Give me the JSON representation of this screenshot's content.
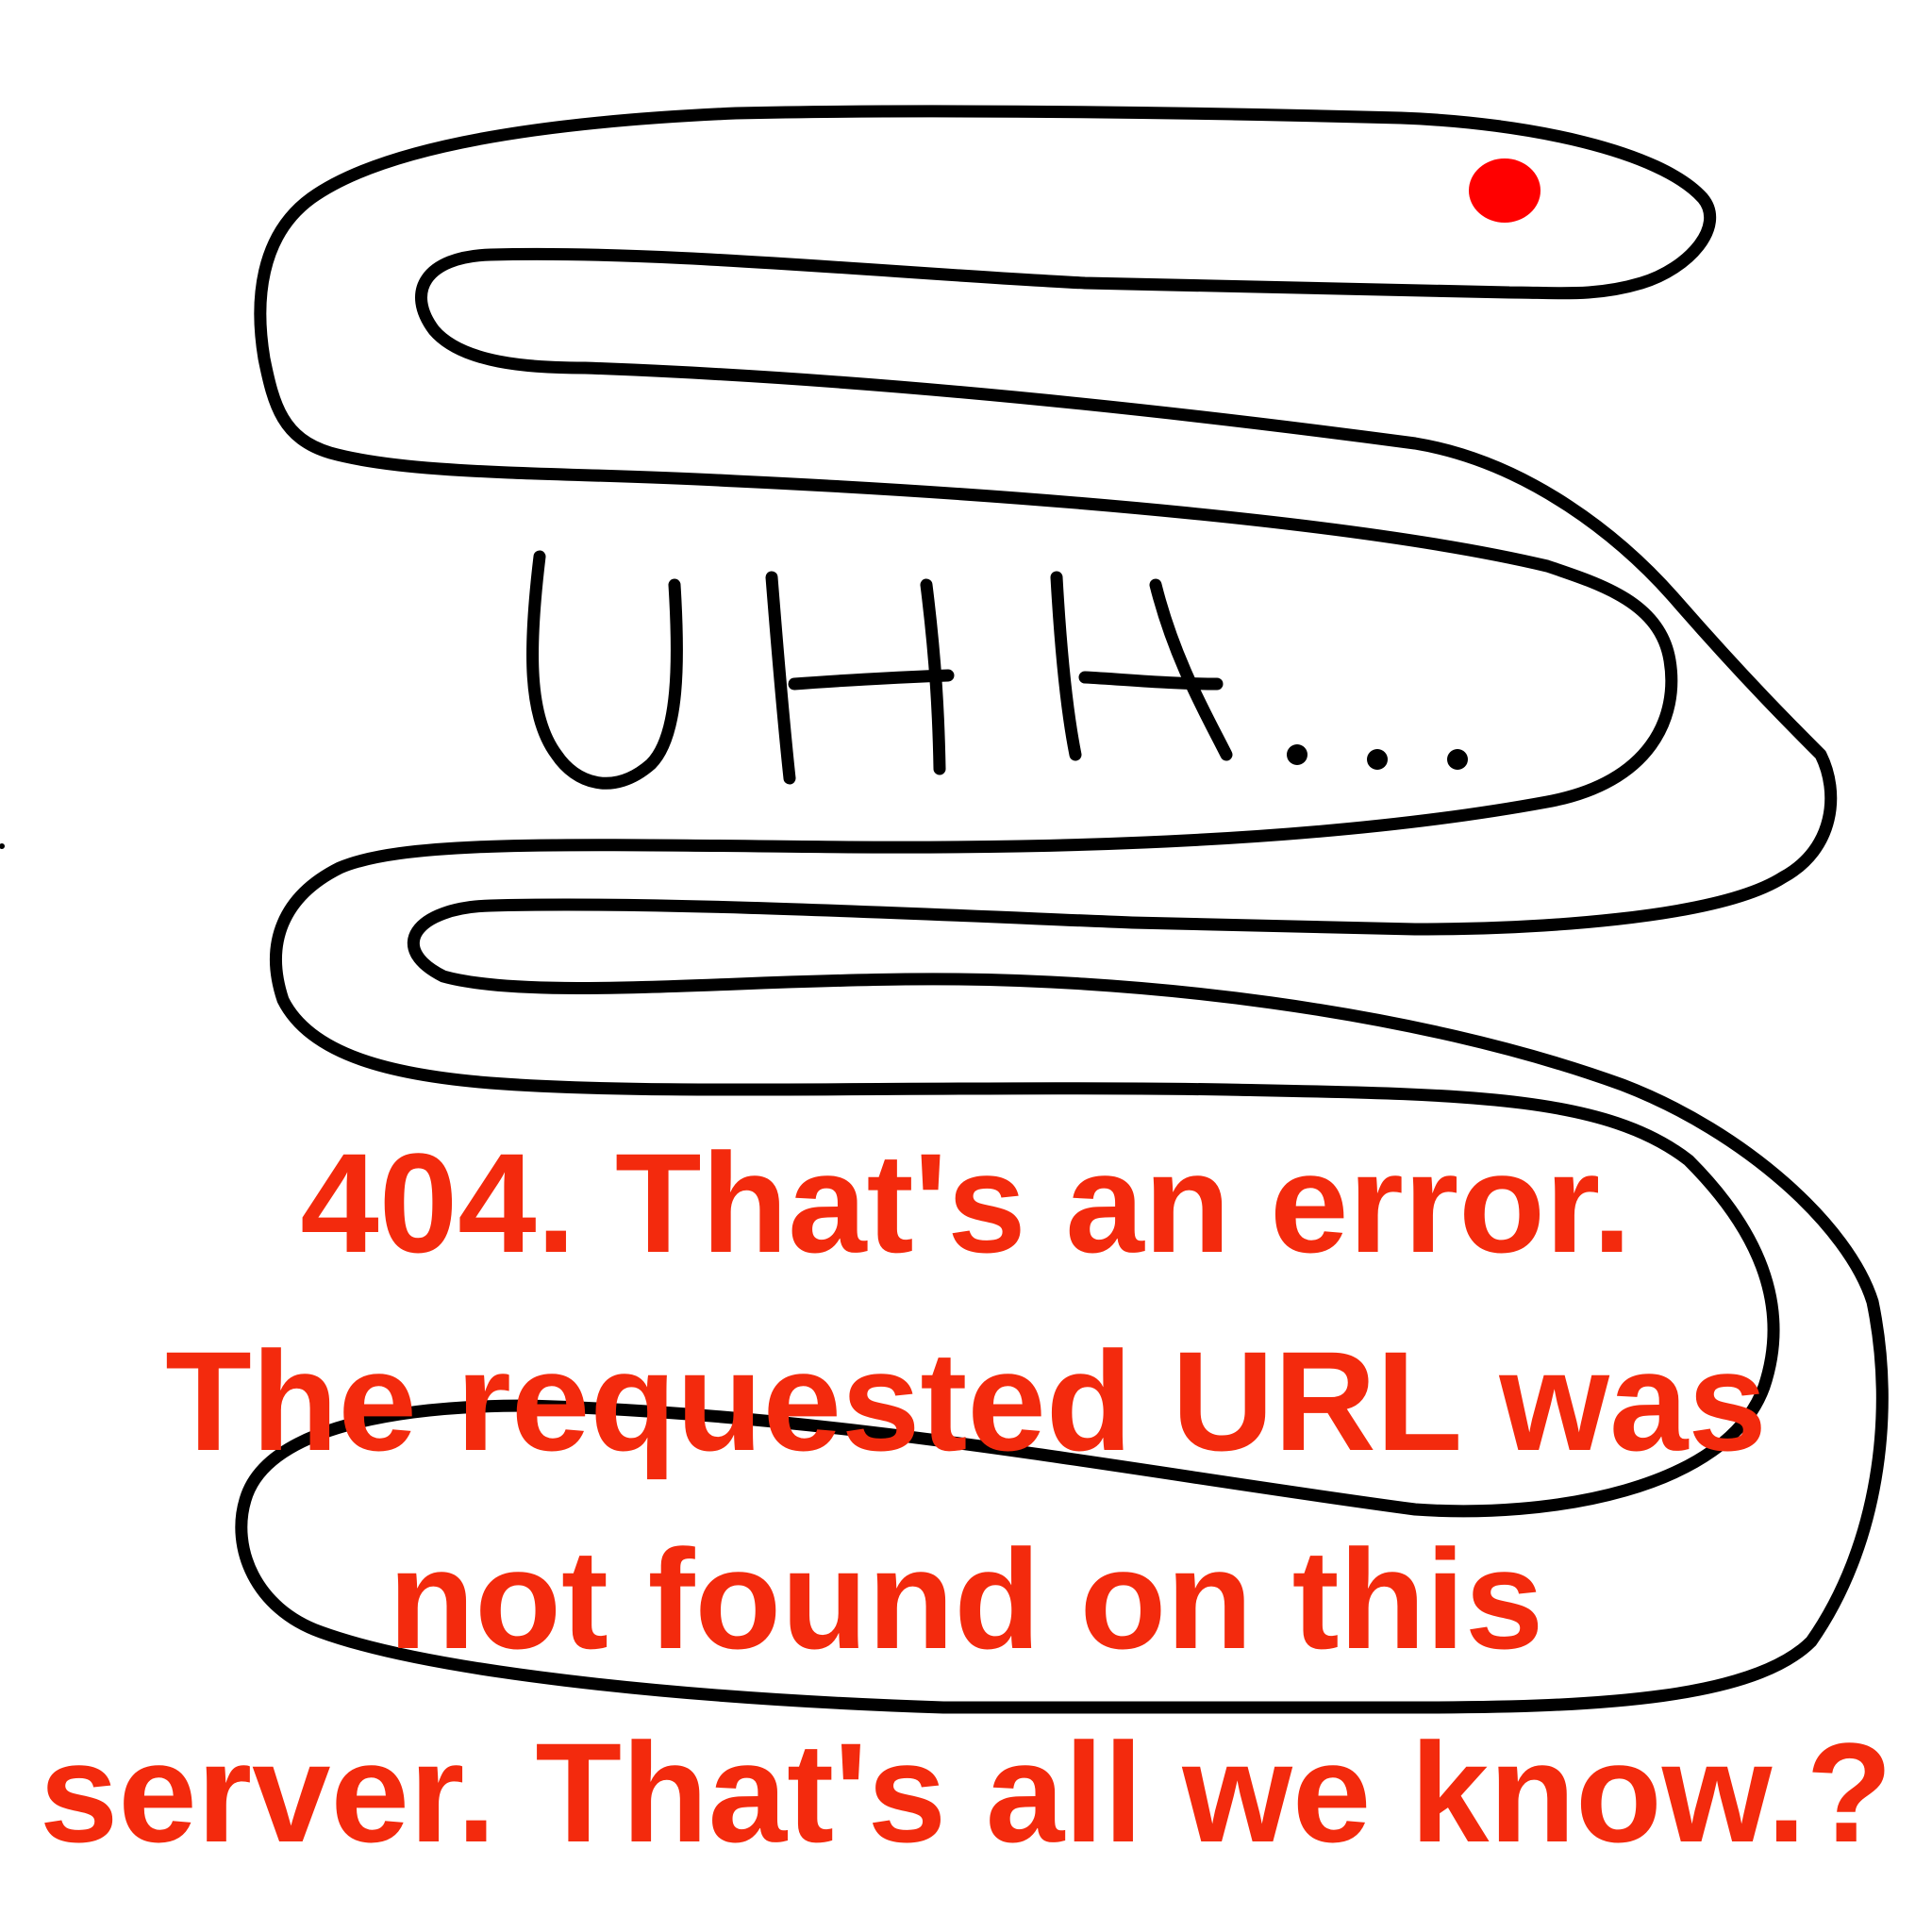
{
  "drawing": {
    "handwritten_text": "UHH...",
    "eye_color": "#ff0000",
    "line_color": "#000000"
  },
  "message": {
    "color": "#f32a0d",
    "lines": [
      "404. That's an error.",
      "The requested URL was",
      "not found on this",
      "server. That's all we know.?"
    ]
  }
}
